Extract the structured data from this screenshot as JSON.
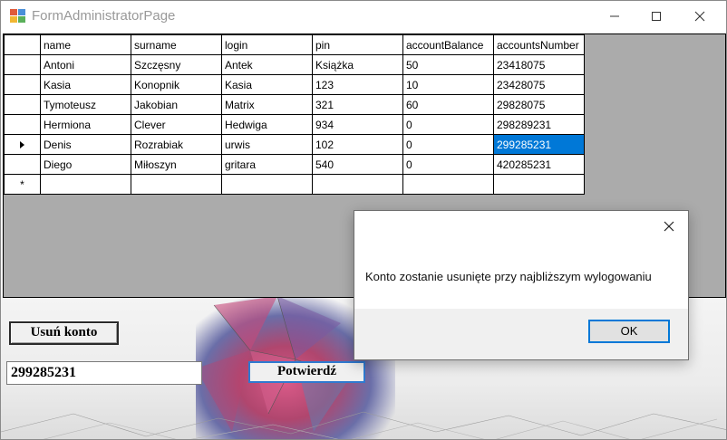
{
  "window": {
    "title": "FormAdministratorPage"
  },
  "grid": {
    "columns": [
      "name",
      "surname",
      "login",
      "pin",
      "accountBalance",
      "accountsNumber"
    ],
    "rows": [
      [
        "Antoni",
        "Szczęsny",
        "Antek",
        "Książka",
        "50",
        "23418075"
      ],
      [
        "Kasia",
        "Konopnik",
        "Kasia",
        "123",
        "10",
        "23428075"
      ],
      [
        "Tymoteusz",
        "Jakobian",
        "Matrix",
        "321",
        "60",
        "29828075"
      ],
      [
        "Hermiona",
        "Clever",
        "Hedwiga",
        "934",
        "0",
        "298289231"
      ],
      [
        "Denis",
        "Rozrabiak",
        "urwis",
        "102",
        "0",
        "299285231"
      ],
      [
        "Diego",
        "Miłoszyn",
        "gritara",
        "540",
        "0",
        "420285231"
      ]
    ],
    "current_row_index": 4,
    "selected_cell": {
      "row": 4,
      "column": "accountsNumber"
    },
    "new_row_marker": "*",
    "selection_color": "#0078d7"
  },
  "form": {
    "delete_button_label": "Usuń konto",
    "account_input_value": "299285231",
    "confirm_button_label": "Potwierdź"
  },
  "dialog": {
    "message": "Konto zostanie usunięte przy najbliższym wylogowaniu",
    "ok_label": "OK",
    "accent_color": "#0078d7"
  }
}
